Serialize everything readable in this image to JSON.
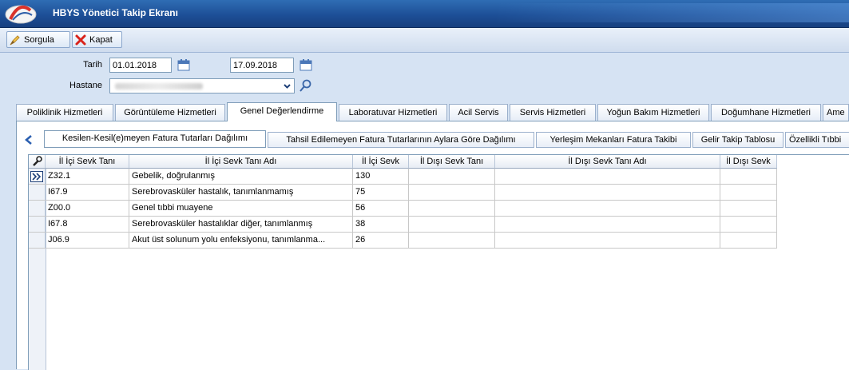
{
  "window": {
    "title": "HBYS Yönetici Takip Ekranı"
  },
  "toolbar": {
    "sorgula": "Sorgula",
    "kapat": "Kapat"
  },
  "form": {
    "tarih_label": "Tarih",
    "date_start": "01.01.2018",
    "date_end": "17.09.2018",
    "hastane_label": "Hastane"
  },
  "main_tabs": [
    "Poliklinik Hizmetleri",
    "Görüntüleme Hizmetleri",
    "Genel Değerlendirme",
    "Laboratuvar Hizmetleri",
    "Acil Servis",
    "Servis Hizmetleri",
    "Yoğun Bakım Hizmetleri",
    "Doğumhane Hizmetleri",
    "Ame"
  ],
  "sub_tabs": [
    "Kesilen-Kesil(e)meyen Fatura Tutarları Dağılımı",
    "Tahsil Edilemeyen Fatura Tutarlarının Aylara Göre Dağılımı",
    "Yerleşim Mekanları Fatura Takibi",
    "Gelir Takip Tablosu",
    "Özellikli Tıbbi"
  ],
  "grid": {
    "columns": [
      "İl İçi Sevk Tanı",
      "İl İçi Sevk Tanı Adı",
      "İl İçi Sevk",
      "İl Dışı Sevk Tanı",
      "İl Dışı Sevk Tanı Adı",
      "İl Dışı Sevk"
    ],
    "rows": [
      [
        "Z32.1",
        "Gebelik, doğrulanmış",
        "130",
        "",
        "",
        ""
      ],
      [
        "I67.9",
        "Serebrovasküler hastalık, tanımlanmamış",
        "75",
        "",
        "",
        ""
      ],
      [
        "Z00.0",
        "Genel tıbbi muayene",
        "56",
        "",
        "",
        ""
      ],
      [
        "I67.8",
        "Serebrovasküler hastalıklar diğer, tanımlanmış",
        "38",
        "",
        "",
        ""
      ],
      [
        "J06.9",
        "Akut üst solunum yolu enfeksiyonu, tanımlanma...",
        "26",
        "",
        "",
        ""
      ]
    ]
  }
}
